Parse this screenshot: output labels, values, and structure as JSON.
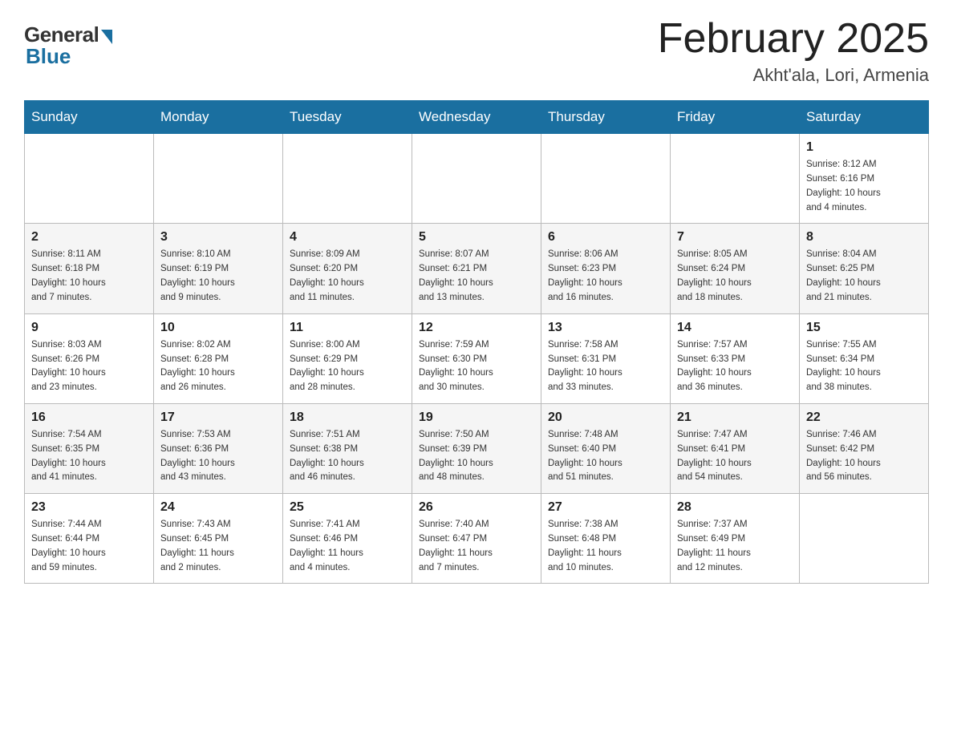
{
  "header": {
    "logo_general": "General",
    "logo_blue": "Blue",
    "month_title": "February 2025",
    "location": "Akht'ala, Lori, Armenia"
  },
  "weekdays": [
    "Sunday",
    "Monday",
    "Tuesday",
    "Wednesday",
    "Thursday",
    "Friday",
    "Saturday"
  ],
  "weeks": [
    [
      {
        "day": "",
        "info": ""
      },
      {
        "day": "",
        "info": ""
      },
      {
        "day": "",
        "info": ""
      },
      {
        "day": "",
        "info": ""
      },
      {
        "day": "",
        "info": ""
      },
      {
        "day": "",
        "info": ""
      },
      {
        "day": "1",
        "info": "Sunrise: 8:12 AM\nSunset: 6:16 PM\nDaylight: 10 hours\nand 4 minutes."
      }
    ],
    [
      {
        "day": "2",
        "info": "Sunrise: 8:11 AM\nSunset: 6:18 PM\nDaylight: 10 hours\nand 7 minutes."
      },
      {
        "day": "3",
        "info": "Sunrise: 8:10 AM\nSunset: 6:19 PM\nDaylight: 10 hours\nand 9 minutes."
      },
      {
        "day": "4",
        "info": "Sunrise: 8:09 AM\nSunset: 6:20 PM\nDaylight: 10 hours\nand 11 minutes."
      },
      {
        "day": "5",
        "info": "Sunrise: 8:07 AM\nSunset: 6:21 PM\nDaylight: 10 hours\nand 13 minutes."
      },
      {
        "day": "6",
        "info": "Sunrise: 8:06 AM\nSunset: 6:23 PM\nDaylight: 10 hours\nand 16 minutes."
      },
      {
        "day": "7",
        "info": "Sunrise: 8:05 AM\nSunset: 6:24 PM\nDaylight: 10 hours\nand 18 minutes."
      },
      {
        "day": "8",
        "info": "Sunrise: 8:04 AM\nSunset: 6:25 PM\nDaylight: 10 hours\nand 21 minutes."
      }
    ],
    [
      {
        "day": "9",
        "info": "Sunrise: 8:03 AM\nSunset: 6:26 PM\nDaylight: 10 hours\nand 23 minutes."
      },
      {
        "day": "10",
        "info": "Sunrise: 8:02 AM\nSunset: 6:28 PM\nDaylight: 10 hours\nand 26 minutes."
      },
      {
        "day": "11",
        "info": "Sunrise: 8:00 AM\nSunset: 6:29 PM\nDaylight: 10 hours\nand 28 minutes."
      },
      {
        "day": "12",
        "info": "Sunrise: 7:59 AM\nSunset: 6:30 PM\nDaylight: 10 hours\nand 30 minutes."
      },
      {
        "day": "13",
        "info": "Sunrise: 7:58 AM\nSunset: 6:31 PM\nDaylight: 10 hours\nand 33 minutes."
      },
      {
        "day": "14",
        "info": "Sunrise: 7:57 AM\nSunset: 6:33 PM\nDaylight: 10 hours\nand 36 minutes."
      },
      {
        "day": "15",
        "info": "Sunrise: 7:55 AM\nSunset: 6:34 PM\nDaylight: 10 hours\nand 38 minutes."
      }
    ],
    [
      {
        "day": "16",
        "info": "Sunrise: 7:54 AM\nSunset: 6:35 PM\nDaylight: 10 hours\nand 41 minutes."
      },
      {
        "day": "17",
        "info": "Sunrise: 7:53 AM\nSunset: 6:36 PM\nDaylight: 10 hours\nand 43 minutes."
      },
      {
        "day": "18",
        "info": "Sunrise: 7:51 AM\nSunset: 6:38 PM\nDaylight: 10 hours\nand 46 minutes."
      },
      {
        "day": "19",
        "info": "Sunrise: 7:50 AM\nSunset: 6:39 PM\nDaylight: 10 hours\nand 48 minutes."
      },
      {
        "day": "20",
        "info": "Sunrise: 7:48 AM\nSunset: 6:40 PM\nDaylight: 10 hours\nand 51 minutes."
      },
      {
        "day": "21",
        "info": "Sunrise: 7:47 AM\nSunset: 6:41 PM\nDaylight: 10 hours\nand 54 minutes."
      },
      {
        "day": "22",
        "info": "Sunrise: 7:46 AM\nSunset: 6:42 PM\nDaylight: 10 hours\nand 56 minutes."
      }
    ],
    [
      {
        "day": "23",
        "info": "Sunrise: 7:44 AM\nSunset: 6:44 PM\nDaylight: 10 hours\nand 59 minutes."
      },
      {
        "day": "24",
        "info": "Sunrise: 7:43 AM\nSunset: 6:45 PM\nDaylight: 11 hours\nand 2 minutes."
      },
      {
        "day": "25",
        "info": "Sunrise: 7:41 AM\nSunset: 6:46 PM\nDaylight: 11 hours\nand 4 minutes."
      },
      {
        "day": "26",
        "info": "Sunrise: 7:40 AM\nSunset: 6:47 PM\nDaylight: 11 hours\nand 7 minutes."
      },
      {
        "day": "27",
        "info": "Sunrise: 7:38 AM\nSunset: 6:48 PM\nDaylight: 11 hours\nand 10 minutes."
      },
      {
        "day": "28",
        "info": "Sunrise: 7:37 AM\nSunset: 6:49 PM\nDaylight: 11 hours\nand 12 minutes."
      },
      {
        "day": "",
        "info": ""
      }
    ]
  ]
}
